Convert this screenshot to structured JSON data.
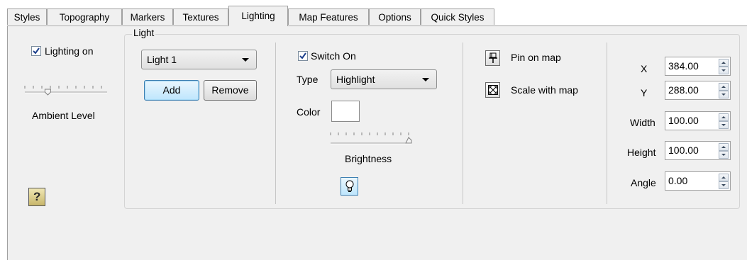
{
  "tabs": [
    "Styles",
    "Topography",
    "Markers",
    "Textures",
    "Lighting",
    "Map Features",
    "Options",
    "Quick Styles"
  ],
  "active_tab": "Lighting",
  "lighting": {
    "lighting_on_label": "Lighting on",
    "lighting_on_checked": true,
    "ambient_level_label": "Ambient Level",
    "ambient_level_value": 0.3
  },
  "light_group": {
    "title": "Light",
    "light_select": "Light 1",
    "add_label": "Add",
    "remove_label": "Remove",
    "switch_on_label": "Switch On",
    "switch_on_checked": true,
    "type_label": "Type",
    "type_value": "Highlight",
    "color_label": "Color",
    "color_value": "#ffffff",
    "brightness_label": "Brightness",
    "brightness_value": 1.0,
    "pin_on_map_label": "Pin on map",
    "scale_with_map_label": "Scale with map"
  },
  "fields": [
    {
      "label": "X",
      "value": "384.00"
    },
    {
      "label": "Y",
      "value": "288.00"
    },
    {
      "label": "Width",
      "value": "100.00"
    },
    {
      "label": "Height",
      "value": "100.00"
    },
    {
      "label": "Angle",
      "value": "0.00"
    }
  ],
  "icons": {
    "help": "help-question-icon",
    "bulb": "light-bulb-icon",
    "pin": "pin-icon",
    "scale": "scale-icon"
  }
}
